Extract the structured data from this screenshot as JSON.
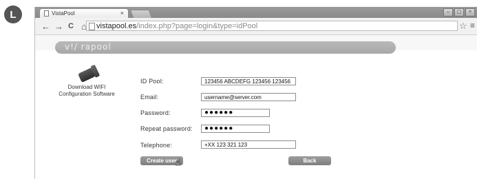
{
  "step_badge": "L",
  "browser": {
    "tab_title": "VistaPool",
    "tab_close": "×",
    "controls": [
      "–",
      "▢",
      "×"
    ],
    "nav_icons": [
      "←",
      "→",
      "C",
      "⌂"
    ],
    "url_host": "vistapool.es",
    "url_path": "/index.php?page=login&type=idPool"
  },
  "brand": {
    "logo_text": "v!/ rapool"
  },
  "download": {
    "line1": "Download WIFI",
    "line2": "Configuration Software"
  },
  "form": {
    "labels": {
      "id_pool": "ID Pool:",
      "email": "Email:",
      "password": "Password:",
      "repeat_password": "Repeat password:",
      "telephone": "Telephone:"
    },
    "values": {
      "id_pool": "123456 ABCDEFG 123456 123456",
      "email": "username@server.com",
      "password": "●●●●●●",
      "repeat_password": "●●●●●●",
      "telephone": "+XX 123 321 123"
    },
    "buttons": {
      "create": "Create user",
      "back": "Back"
    }
  }
}
